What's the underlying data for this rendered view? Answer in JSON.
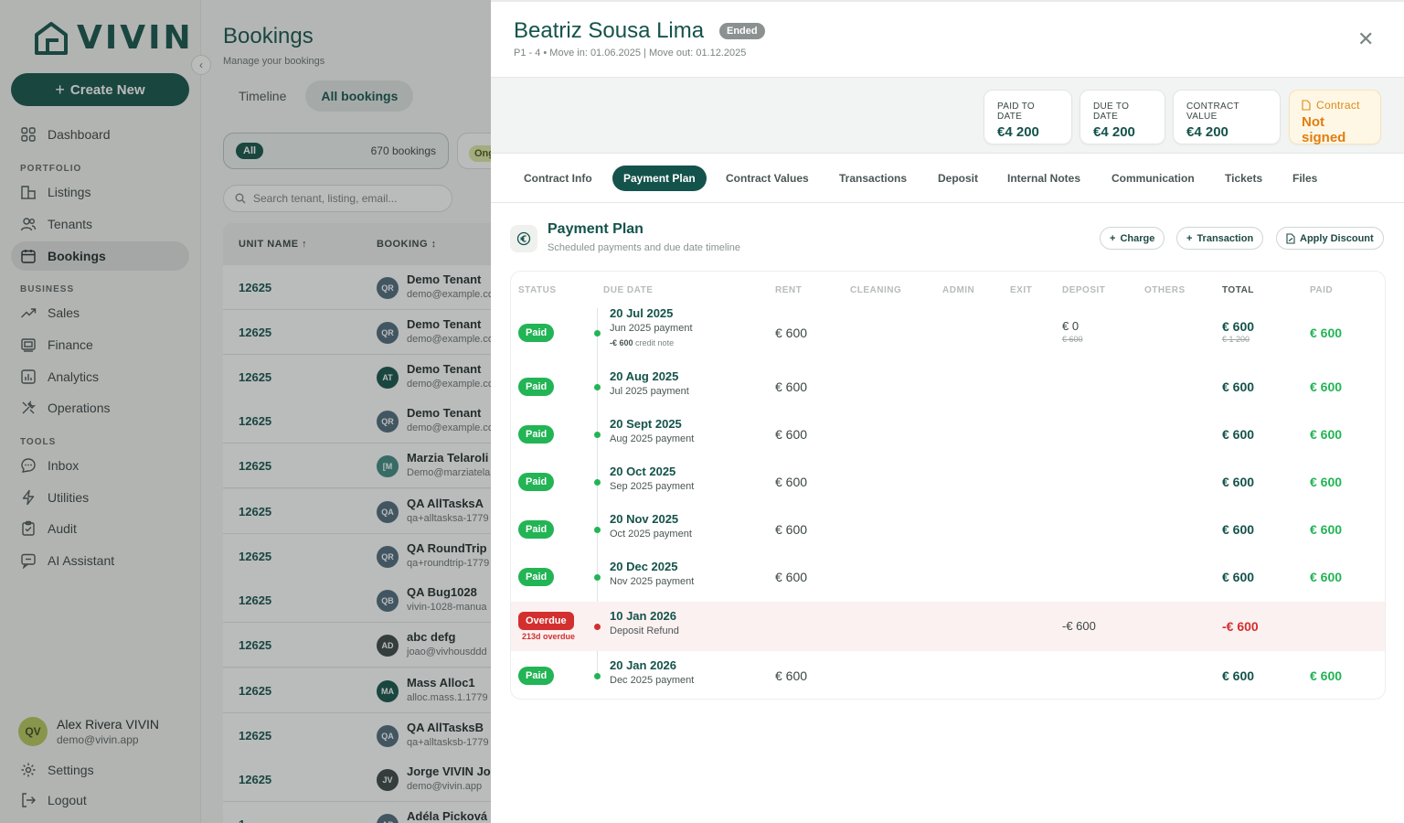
{
  "brand": {
    "name": "VIVIN"
  },
  "sidebar": {
    "create_label": "Create New",
    "dashboard": "Dashboard",
    "sections": {
      "portfolio": "PORTFOLIO",
      "business": "BUSINESS",
      "tools": "TOOLS"
    },
    "portfolio_items": [
      "Listings",
      "Tenants",
      "Bookings"
    ],
    "business_items": [
      "Sales",
      "Finance",
      "Analytics",
      "Operations"
    ],
    "tools_items": [
      "Inbox",
      "Utilities",
      "Audit",
      "AI Assistant"
    ],
    "user": {
      "initials": "QV",
      "name": "Alex Rivera VIVIN",
      "email": "demo@vivin.app"
    },
    "settings": "Settings",
    "logout": "Logout"
  },
  "bookings": {
    "title": "Bookings",
    "subtitle": "Manage your bookings",
    "tabs": [
      "Timeline",
      "All bookings"
    ],
    "filter_all_label": "All",
    "filter_all_count": "670 bookings",
    "filter_ongoing_label": "Ong",
    "search_placeholder": "Search tenant, listing, email...",
    "col_unit": "UNIT NAME",
    "col_booking": "BOOKING",
    "rows": [
      {
        "unit": "12625",
        "initials": "QR",
        "name": "Demo Tenant",
        "email": "demo@example.com"
      },
      {
        "unit": "12625",
        "initials": "QR",
        "name": "Demo Tenant",
        "email": "demo@example.com"
      },
      {
        "unit": "12625",
        "initials": "AT",
        "name": "Demo Tenant",
        "email": "demo@example.com"
      },
      {
        "unit": "12625",
        "initials": "QR",
        "name": "Demo Tenant",
        "email": "demo@example.com"
      },
      {
        "unit": "12625",
        "initials": "[M",
        "name": "Marzia Telaroli",
        "email": "Demo@marziatela"
      },
      {
        "unit": "12625",
        "initials": "QA",
        "name": "QA AllTasksA",
        "email": "qa+alltasksa-1779"
      },
      {
        "unit": "12625",
        "initials": "QR",
        "name": "QA RoundTrip",
        "email": "qa+roundtrip-1779"
      },
      {
        "unit": "12625",
        "initials": "QB",
        "name": "QA Bug1028",
        "email": "vivin-1028-manua"
      },
      {
        "unit": "12625",
        "initials": "AD",
        "name": "abc defg",
        "email": "joao@vivhousddd"
      },
      {
        "unit": "12625",
        "initials": "MA",
        "name": "Mass Alloc1",
        "email": "alloc.mass.1.1779"
      },
      {
        "unit": "12625",
        "initials": "QA",
        "name": "QA AllTasksB",
        "email": "qa+alltasksb-1779"
      },
      {
        "unit": "12625",
        "initials": "JV",
        "name": "Jorge VIVIN Jo",
        "email": "demo@vivin.app"
      },
      {
        "unit": "1",
        "initials": "AP",
        "name": "Adéla Picková",
        "email": ""
      }
    ]
  },
  "drawer": {
    "tenant_name": "Beatriz Sousa Lima",
    "status_badge": "Ended",
    "meta": "P1 - 4 • Move in: 01.06.2025 | Move out: 01.12.2025",
    "cards": {
      "paid_label": "PAID TO DATE",
      "paid_value": "€4 200",
      "due_label": "DUE TO DATE",
      "due_value": "€4 200",
      "contract_label": "CONTRACT VALUE",
      "contract_value": "€4 200",
      "signed_label": "Contract",
      "signed_value": "Not signed"
    },
    "tabs": [
      "Contract Info",
      "Payment Plan",
      "Contract Values",
      "Transactions",
      "Deposit",
      "Internal Notes",
      "Communication",
      "Tickets",
      "Files"
    ],
    "section_title": "Payment Plan",
    "section_subtitle": "Scheduled payments and due date timeline",
    "actions": [
      "Charge",
      "Transaction",
      "Apply Discount"
    ],
    "columns": [
      "STATUS",
      "DUE DATE",
      "RENT",
      "CLEANING",
      "ADMIN",
      "EXIT",
      "DEPOSIT",
      "OTHERS",
      "TOTAL",
      "PAID"
    ],
    "payments": [
      {
        "status": "Paid",
        "date": "20 Jul 2025",
        "desc": "Jun 2025 payment",
        "credit_amount": "-€ 600",
        "credit_label": "credit note",
        "rent": "€ 600",
        "deposit": "€ 0",
        "deposit_old": "€ 600",
        "total": "€ 600",
        "total_old": "€ 1 200",
        "paid": "€ 600"
      },
      {
        "status": "Paid",
        "date": "20 Aug 2025",
        "desc": "Jul 2025 payment",
        "rent": "€ 600",
        "total": "€ 600",
        "paid": "€ 600"
      },
      {
        "status": "Paid",
        "date": "20 Sept 2025",
        "desc": "Aug 2025 payment",
        "rent": "€ 600",
        "total": "€ 600",
        "paid": "€ 600"
      },
      {
        "status": "Paid",
        "date": "20 Oct 2025",
        "desc": "Sep 2025 payment",
        "rent": "€ 600",
        "total": "€ 600",
        "paid": "€ 600"
      },
      {
        "status": "Paid",
        "date": "20 Nov 2025",
        "desc": "Oct 2025 payment",
        "rent": "€ 600",
        "total": "€ 600",
        "paid": "€ 600"
      },
      {
        "status": "Paid",
        "date": "20 Dec 2025",
        "desc": "Nov 2025 payment",
        "rent": "€ 600",
        "total": "€ 600",
        "paid": "€ 600"
      },
      {
        "status": "Overdue",
        "overdue_days": "213d overdue",
        "date": "10 Jan 2026",
        "desc": "Deposit Refund",
        "deposit": "-€ 600",
        "total": "-€ 600"
      },
      {
        "status": "Paid",
        "date": "20 Jan 2026",
        "desc": "Dec 2025 payment",
        "rent": "€ 600",
        "total": "€ 600",
        "paid": "€ 600"
      }
    ]
  }
}
